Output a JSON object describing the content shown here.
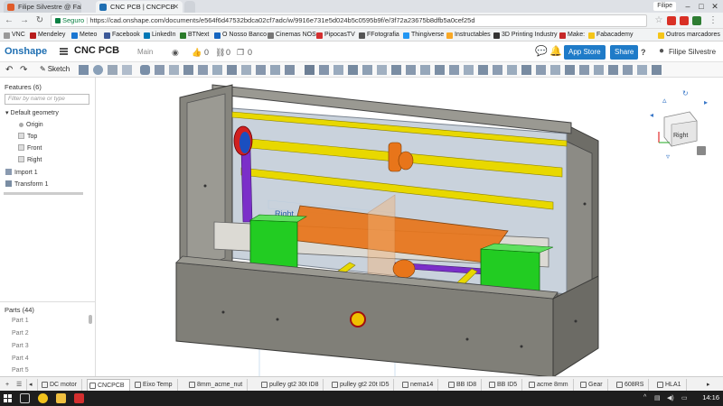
{
  "browser": {
    "tabs": [
      {
        "title": "Filipe Silvestre @ Fab Ac",
        "favicon_color": "#e05c2a",
        "active": false
      },
      {
        "title": "CNC PCB | CNCPCB",
        "favicon_color": "#1f6fb2",
        "active": true
      }
    ],
    "user": "Filipe",
    "secure_label": "Seguro",
    "url": "https://cad.onshape.com/documents/e564f6d47532bdca02cf7adc/w/9916e731e5d024b5c0595b9f/e/3f72a23675b8dfb5a0cef25d"
  },
  "bookmarks": [
    {
      "label": "VNC",
      "color": "#999999"
    },
    {
      "label": "Mendeley",
      "color": "#b71c1c"
    },
    {
      "label": "Meteo",
      "color": "#1976d2"
    },
    {
      "label": "Facebook",
      "color": "#3b5998"
    },
    {
      "label": "LinkedIn",
      "color": "#0077b5"
    },
    {
      "label": "BTNext",
      "color": "#2a7b2a"
    },
    {
      "label": "O Nosso Banco",
      "color": "#1565c0"
    },
    {
      "label": "Cinemas NOS",
      "color": "#777777"
    },
    {
      "label": "PipocasTV",
      "color": "#d32f2f"
    },
    {
      "label": "FFotografia",
      "color": "#555555"
    },
    {
      "label": "Thingiverse",
      "color": "#2196f3"
    },
    {
      "label": "Instructables",
      "color": "#f9a825"
    },
    {
      "label": "3D Printing Industry",
      "color": "#333333"
    },
    {
      "label": "Make:",
      "color": "#c62828"
    },
    {
      "label": "Fabacademy",
      "color": "#f5c518"
    },
    {
      "label": "Outros marcadores",
      "color": "#f5c518"
    }
  ],
  "onshape": {
    "logo": "Onshape",
    "doc_name": "CNC PCB",
    "branch": "Main",
    "likes": "0",
    "links": "0",
    "copies": "0",
    "app_store": "App Store",
    "share": "Share",
    "help": "?",
    "user_name": "Filipe Silvestre"
  },
  "toolbar": {
    "sketch_label": "Sketch"
  },
  "feature_panel": {
    "title": "Features (6)",
    "search_placeholder": "Filter by name or type",
    "group": "Default geometry",
    "items": [
      "Origin",
      "Top",
      "Front",
      "Right"
    ],
    "features": [
      "Import 1",
      "Transform 1"
    ]
  },
  "parts_panel": {
    "title": "Parts (44)",
    "items": [
      "Part 1",
      "Part 2",
      "Part 3",
      "Part 4",
      "Part 5"
    ]
  },
  "viewport": {
    "plane_label": "Right",
    "viewcube_label": "Right",
    "colors": {
      "frame": "#807f78",
      "rail": "#e8d800",
      "motor": "#22cc22",
      "bed": "#e8751a",
      "backplate": "#cfd6df",
      "purple": "#7b2fc9"
    }
  },
  "bottom_tabs": [
    {
      "label": "DC motor",
      "active": false
    },
    {
      "label": "CNCPCB",
      "active": true
    },
    {
      "label": "Eixo Temp",
      "active": false
    },
    {
      "label": "8mm_acme_nut",
      "active": false
    },
    {
      "label": "pulley gt2 30t ID8",
      "active": false
    },
    {
      "label": "pulley gt2 20t ID5",
      "active": false
    },
    {
      "label": "nema14",
      "active": false
    },
    {
      "label": "BB ID8",
      "active": false
    },
    {
      "label": "BB ID5",
      "active": false
    },
    {
      "label": "acme 8mm",
      "active": false
    },
    {
      "label": "Gear",
      "active": false
    },
    {
      "label": "608RS",
      "active": false
    },
    {
      "label": "HLA1",
      "active": false
    }
  ],
  "taskbar": {
    "clock": "14:16"
  }
}
